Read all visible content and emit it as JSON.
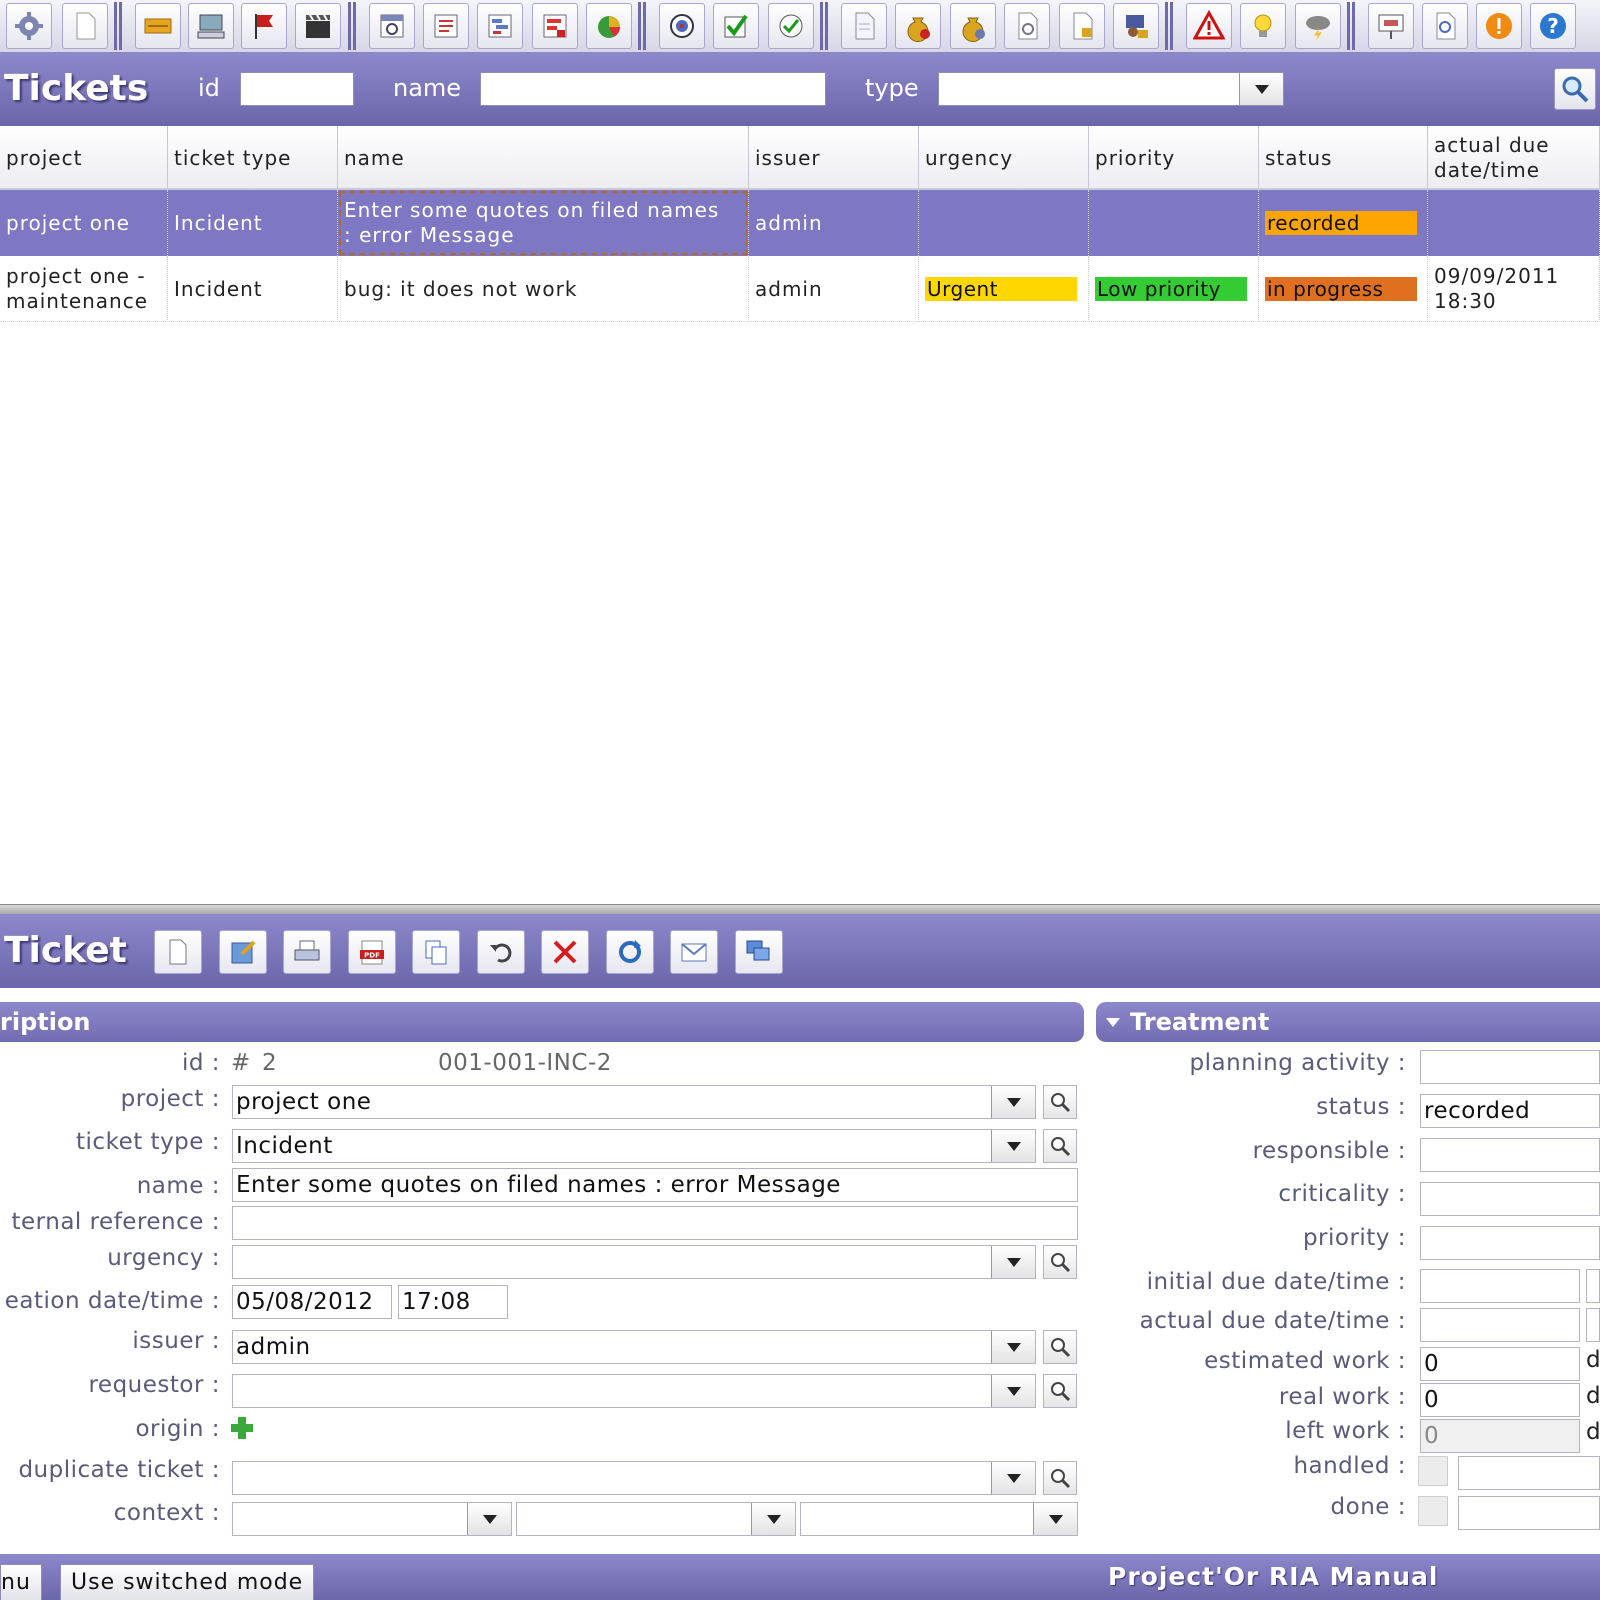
{
  "toolbar": {
    "icons": [
      "gear-icon",
      "new-document-icon",
      "ticket-icon",
      "computer-icon",
      "flag-icon",
      "clapperboard-icon",
      "calendar-icon",
      "checklist-icon",
      "gantt-icon",
      "report-icon",
      "pie-chart-icon",
      "target-icon",
      "checkmark-icon",
      "review-icon",
      "page-icon",
      "money-bag-icon",
      "money-gear-icon",
      "document-gear-icon",
      "document-lock-icon",
      "user-lock-icon",
      "warning-icon",
      "lightbulb-icon",
      "storm-icon",
      "presentation-icon",
      "document-search-icon",
      "alert-icon",
      "help-icon"
    ]
  },
  "list": {
    "title": "Tickets",
    "filters": {
      "id_label": "id",
      "id_value": "",
      "name_label": "name",
      "name_value": "",
      "type_label": "type",
      "type_value": ""
    },
    "columns": [
      "project",
      "ticket type",
      "name",
      "issuer",
      "urgency",
      "priority",
      "status",
      "actual due date/time"
    ],
    "rows": [
      {
        "project": "project one",
        "ticket_type": "Incident",
        "name": "Enter some quotes on filed names : error Message",
        "issuer": "admin",
        "urgency": "",
        "priority": "",
        "status": "recorded",
        "actual_due": ""
      },
      {
        "project": "project one - maintenance",
        "ticket_type": "Incident",
        "name": "bug: it does not work",
        "issuer": "admin",
        "urgency": "Urgent",
        "priority": "Low priority",
        "status": "in progress",
        "actual_due": "09/09/2011 18:30"
      }
    ],
    "colors": {
      "recorded": "#ffa500",
      "in_progress": "#e0701f",
      "urgent": "#ffd700",
      "low_priority": "#33cc33"
    }
  },
  "detail": {
    "title": "Ticket",
    "toolbar_icons": [
      "new-icon",
      "save-icon",
      "print-icon",
      "pdf-icon",
      "copy-icon",
      "undo-icon",
      "delete-icon",
      "refresh-icon",
      "email-icon",
      "multiple-update-icon"
    ],
    "description": {
      "section_label": "ription",
      "id_label": "id :",
      "id_hash": "#",
      "id_value": "2",
      "reference": "001-001-INC-2",
      "project_label": "project :",
      "project_value": "project one",
      "ticket_type_label": "ticket type :",
      "ticket_type_value": "Incident",
      "name_label": "name :",
      "name_value": "Enter some quotes on filed names : error Message",
      "external_ref_label": "ternal reference :",
      "external_ref_value": "",
      "urgency_label": "urgency :",
      "urgency_value": "",
      "creation_label": "eation date/time :",
      "creation_date": "05/08/2012",
      "creation_time": "17:08",
      "issuer_label": "issuer :",
      "issuer_value": "admin",
      "requestor_label": "requestor :",
      "requestor_value": "",
      "origin_label": "origin :",
      "duplicate_label": "duplicate ticket :",
      "duplicate_value": "",
      "context_label": "context :"
    },
    "treatment": {
      "section_label": "Treatment",
      "planning_label": "planning activity :",
      "planning_value": "",
      "status_label": "status :",
      "status_value": "recorded",
      "responsible_label": "responsible :",
      "responsible_value": "",
      "criticality_label": "criticality :",
      "criticality_value": "",
      "priority_label": "priority :",
      "priority_value": "",
      "initial_due_label": "initial due date/time :",
      "actual_due_label": "actual due date/time :",
      "estimated_label": "estimated work :",
      "estimated_value": "0",
      "real_label": "real work :",
      "real_value": "0",
      "left_label": "left work :",
      "left_value": "0",
      "unit": "d",
      "handled_label": "handled :",
      "done_label": "done :"
    }
  },
  "footer": {
    "menu_label": "nu",
    "switch_label": "Use switched mode",
    "app_title": "Project'Or RIA Manual"
  }
}
